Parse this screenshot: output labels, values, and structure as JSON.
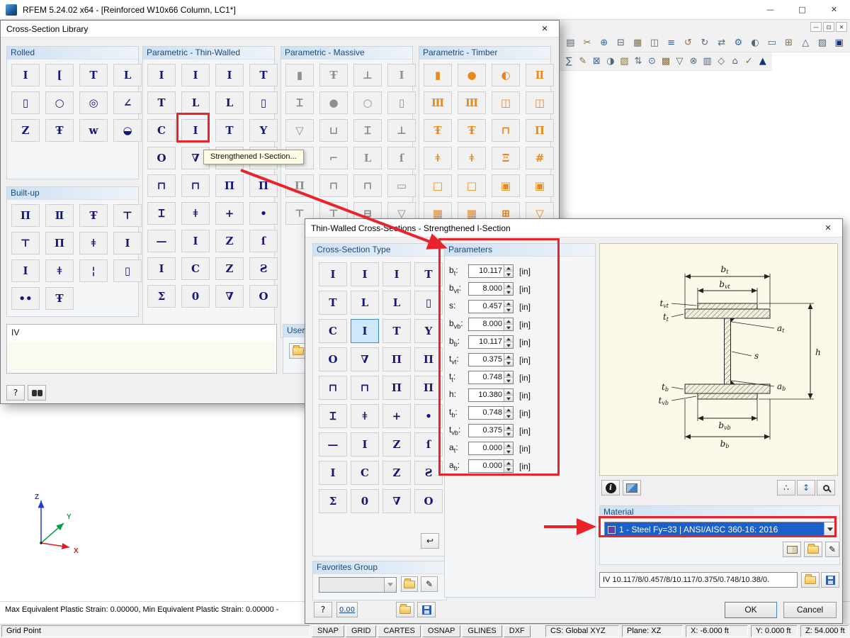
{
  "titlebar": {
    "title": "RFEM 5.24.02 x64 - [Reinforced W10x66 Column, LC1*]",
    "minimize": "—",
    "maximize": "□",
    "close": "✕"
  },
  "mdi": {
    "minimize": "—",
    "restore": "⊡",
    "close": "✕"
  },
  "toolbars": {
    "row1": [
      "▤",
      "✂",
      "⊕",
      "⊟",
      "▦",
      "◫",
      "≡",
      "↺",
      "↻",
      "⇄",
      "⚙",
      "◐",
      "▭",
      "⊞",
      "△",
      "▧",
      "▣"
    ],
    "row2": [
      "∑",
      "✎",
      "⊠",
      "◑",
      "▨",
      "⇅",
      "⊙",
      "▩",
      "▽",
      "⊗",
      "▥",
      "◇",
      "⌂",
      "✓",
      "▲"
    ]
  },
  "axes": {
    "x": "X",
    "y": "Y",
    "z": "Z"
  },
  "canvas_message": "Max Equivalent Plastic Strain: 0.00000, Min Equivalent Plastic Strain: 0.00000 -",
  "statusbar": {
    "mode": "Grid Point",
    "toggles": [
      "SNAP",
      "GRID",
      "CARTES",
      "OSNAP",
      "GLINES",
      "DXF"
    ],
    "cs": "CS: Global XYZ",
    "plane": "Plane: XZ",
    "coord_x": "X:  -6.000 ft",
    "coord_y": "Y:  0.000 ft",
    "coord_z": "Z:  54.000 ft"
  },
  "punct": {
    "colon": ":"
  },
  "library": {
    "title": "Cross-Section Library",
    "close": "✕",
    "help": "?",
    "tooltip": "Strengthened I-Section...",
    "selection_label": "IV",
    "user_label": "User",
    "groups": {
      "rolled": {
        "label": "Rolled",
        "icons": [
          "I",
          "[",
          "T",
          "L",
          "▯",
          "○",
          "◎",
          "∠",
          "Z",
          "Ŧ",
          "w",
          "◒"
        ]
      },
      "thin": {
        "label": "Parametric - Thin-Walled",
        "icons": [
          "I",
          "I",
          "I",
          "T",
          "T",
          "L",
          "L",
          "▯",
          "C",
          "I",
          "T",
          "Y",
          "O",
          "∇",
          "Π",
          "Π",
          "⊓",
          "⊓",
          "Π",
          "Π",
          "Ɪ",
          "ǂ",
          "+",
          "•",
          "—",
          "I",
          "Z",
          "ſ",
          "I",
          "C",
          "Z",
          "Ƨ",
          "Σ",
          "0",
          "∇",
          "O"
        ]
      },
      "massive": {
        "label": "Parametric - Massive",
        "icons": [
          "▮",
          "Ŧ",
          "⊥",
          "I",
          "Ɪ",
          "●",
          "○",
          "▯",
          "▽",
          "⊔",
          "Ɪ",
          "⊥",
          "Γ",
          "⌐",
          "L",
          "ſ",
          "Π",
          "⊓",
          "⊓",
          "▭",
          "⊤",
          "⊤",
          "⊟",
          "▽"
        ]
      },
      "timber": {
        "label": "Parametric - Timber",
        "icons": [
          "▮",
          "●",
          "◐",
          "Ⅱ",
          "Ⅲ",
          "Ⅲ",
          "◫",
          "◫",
          "Ŧ",
          "Ŧ",
          "⊓",
          "Π",
          "ǂ",
          "ǂ",
          "Ξ",
          "#",
          "□",
          "□",
          "▣",
          "▣",
          "▦",
          "▦",
          "⊞",
          "▽"
        ]
      },
      "built": {
        "label": "Built-up",
        "icons": [
          "Π",
          "Ⅱ",
          "Ŧ",
          "⊤",
          "⊤",
          "Π",
          "ǂ",
          "Ⅰ",
          "Ⅰ",
          "ǂ",
          "¦",
          "▯",
          "••",
          "Ŧ"
        ]
      }
    }
  },
  "dialog": {
    "title": "Thin-Walled Cross-Sections - Strengthened I-Section",
    "close": "✕",
    "type": {
      "label": "Cross-Section Type",
      "selected_index": 9,
      "icons": [
        "I",
        "I",
        "I",
        "T",
        "T",
        "L",
        "L",
        "▯",
        "C",
        "I",
        "T",
        "Y",
        "O",
        "∇",
        "Π",
        "Π",
        "⊓",
        "⊓",
        "Π",
        "Π",
        "Ɪ",
        "ǂ",
        "+",
        "•",
        "—",
        "I",
        "Z",
        "ſ",
        "I",
        "C",
        "Z",
        "Ƨ",
        "Σ",
        "0",
        "∇",
        "O"
      ],
      "undo_icon": "↩"
    },
    "parameters": {
      "label": "Parameters",
      "unit": "[in]",
      "rows": [
        {
          "sym": "b",
          "sub": "t",
          "value": "10.117"
        },
        {
          "sym": "b",
          "sub": "vt",
          "value": "8.000"
        },
        {
          "sym": "s",
          "sub": "",
          "value": "0.457"
        },
        {
          "sym": "b",
          "sub": "vb",
          "value": "8.000"
        },
        {
          "sym": "b",
          "sub": "b",
          "value": "10.117"
        },
        {
          "sym": "t",
          "sub": "vt",
          "value": "0.375"
        },
        {
          "sym": "t",
          "sub": "t",
          "value": "0.748"
        },
        {
          "sym": "h",
          "sub": "",
          "value": "10.380"
        },
        {
          "sym": "t",
          "sub": "b",
          "value": "0.748"
        },
        {
          "sym": "t",
          "sub": "vb",
          "value": "0.375"
        },
        {
          "sym": "a",
          "sub": "t",
          "value": "0.000"
        },
        {
          "sym": "a",
          "sub": "b",
          "value": "0.000"
        }
      ]
    },
    "diagram": {
      "labels": [
        {
          "m": "b",
          "s": "t"
        },
        {
          "m": "b",
          "s": "vt"
        },
        {
          "m": "t",
          "s": "vt"
        },
        {
          "m": "t",
          "s": "t"
        },
        {
          "m": "a",
          "s": "t"
        },
        {
          "m": "s",
          "s": ""
        },
        {
          "m": "h",
          "s": ""
        },
        {
          "m": "t",
          "s": "b"
        },
        {
          "m": "t",
          "s": "vb"
        },
        {
          "m": "a",
          "s": "b"
        },
        {
          "m": "b",
          "s": "vb"
        },
        {
          "m": "b",
          "s": "b"
        }
      ]
    },
    "material": {
      "label": "Material",
      "value": "1 - Steel Fy=33 | ANSI/AISC 360-16: 2016"
    },
    "favorites": {
      "label": "Favorites Group"
    },
    "designation": "IV 10.117/8/0.457/8/10.117/0.375/0.748/10.38/0.",
    "buttons": {
      "ok": "OK",
      "cancel": "Cancel",
      "units": "0.00",
      "help": "?",
      "info": "i",
      "dots": "∴",
      "dim": "↕",
      "edit": "✎",
      "new": "✚"
    }
  }
}
